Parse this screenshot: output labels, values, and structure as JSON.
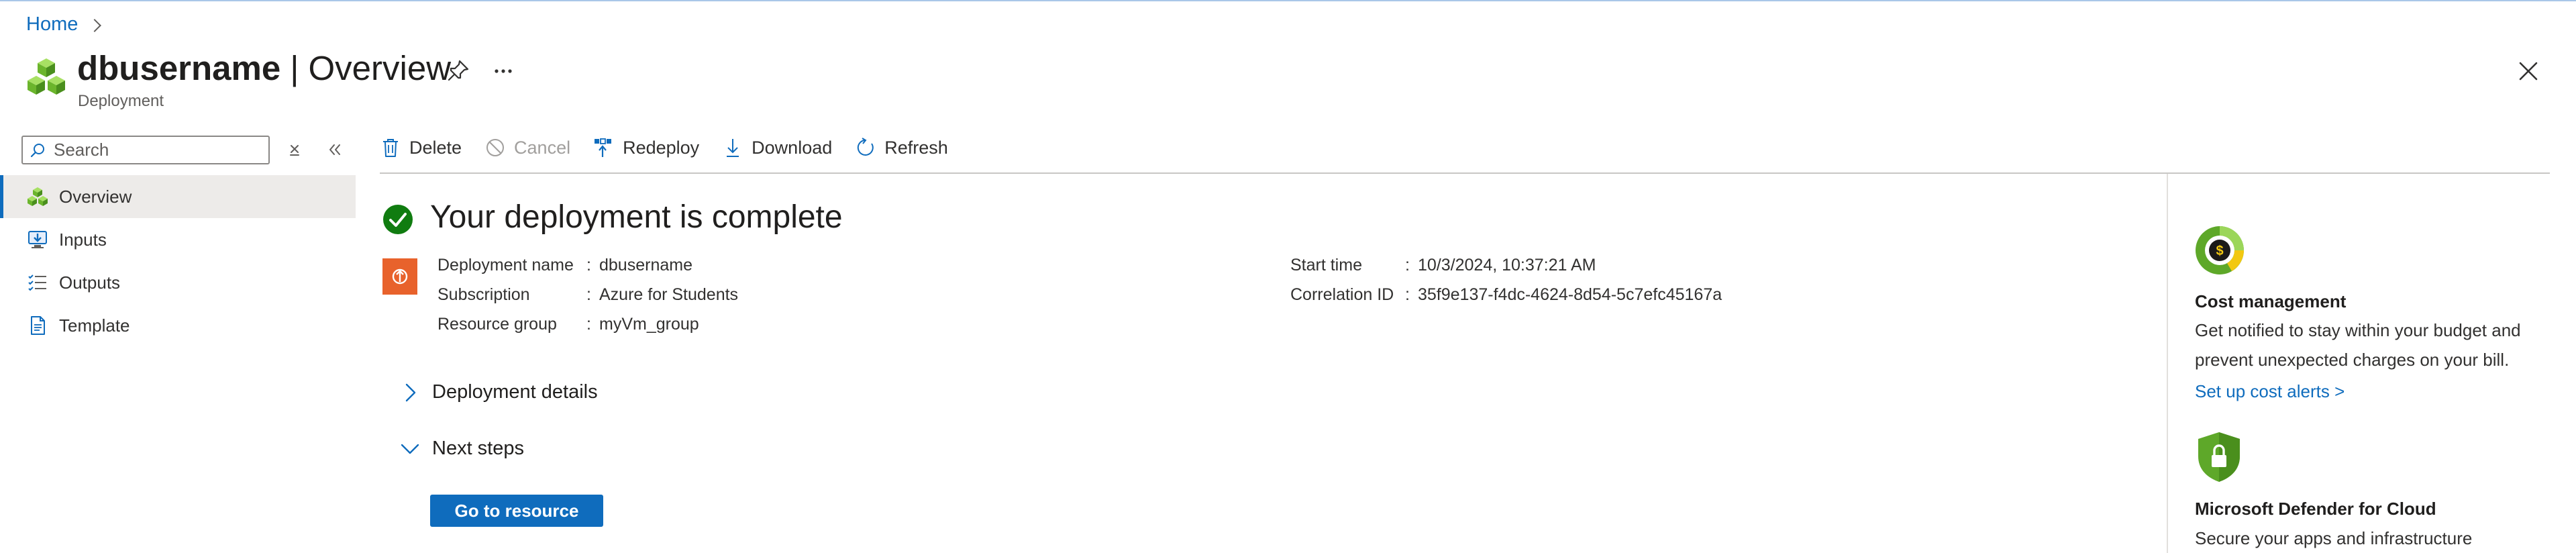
{
  "breadcrumb": {
    "home": "Home"
  },
  "header": {
    "resource_name": "dbusername",
    "separator": "|",
    "page": "Overview",
    "subtitle": "Deployment"
  },
  "search": {
    "placeholder": "Search"
  },
  "nav": {
    "items": [
      {
        "label": "Overview",
        "icon": "overview-icon",
        "selected": true
      },
      {
        "label": "Inputs",
        "icon": "inputs-icon",
        "selected": false
      },
      {
        "label": "Outputs",
        "icon": "outputs-icon",
        "selected": false
      },
      {
        "label": "Template",
        "icon": "template-icon",
        "selected": false
      }
    ]
  },
  "toolbar": {
    "delete": "Delete",
    "cancel": "Cancel",
    "redeploy": "Redeploy",
    "download": "Download",
    "refresh": "Refresh"
  },
  "status": {
    "title": "Your deployment is complete"
  },
  "details": {
    "deployment_name_label": "Deployment name",
    "deployment_name": "dbusername",
    "subscription_label": "Subscription",
    "subscription": "Azure for Students",
    "resource_group_label": "Resource group",
    "resource_group": "myVm_group",
    "start_time_label": "Start time",
    "start_time": "10/3/2024, 10:37:21 AM",
    "correlation_label": "Correlation ID",
    "correlation_id": "35f9e137-f4dc-4624-8d54-5c7efc45167a",
    "colon": ":"
  },
  "sections": {
    "deployment_details": "Deployment details",
    "next_steps": "Next steps"
  },
  "actions": {
    "go_to_resource": "Go to resource"
  },
  "right_panel": {
    "cost": {
      "title": "Cost management",
      "line1": "Get notified to stay within your budget and",
      "line2": "prevent unexpected charges on your bill.",
      "link": "Set up cost alerts >"
    },
    "defender": {
      "title": "Microsoft Defender for Cloud",
      "line1": "Secure your apps and infrastructure"
    }
  },
  "colors": {
    "accent": "#0f6cbd",
    "success": "#107c10",
    "deployment_icon": "#e8622c",
    "defender_green": "#5ea829"
  }
}
